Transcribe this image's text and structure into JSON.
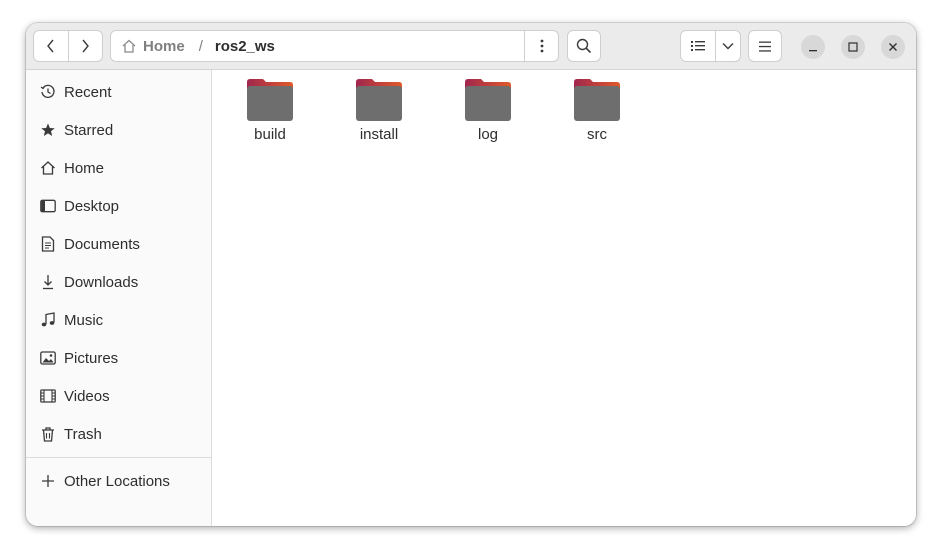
{
  "header": {
    "path_home_label": "Home",
    "path_separator": "/",
    "path_current": "ros2_ws"
  },
  "sidebar": {
    "items": [
      {
        "label": "Recent",
        "icon": "clock-icon"
      },
      {
        "label": "Starred",
        "icon": "star-icon"
      },
      {
        "label": "Home",
        "icon": "home-icon"
      },
      {
        "label": "Desktop",
        "icon": "desktop-icon"
      },
      {
        "label": "Documents",
        "icon": "document-icon"
      },
      {
        "label": "Downloads",
        "icon": "download-icon"
      },
      {
        "label": "Music",
        "icon": "music-note-icon"
      },
      {
        "label": "Pictures",
        "icon": "picture-icon"
      },
      {
        "label": "Videos",
        "icon": "film-icon"
      },
      {
        "label": "Trash",
        "icon": "trash-icon"
      }
    ],
    "other_locations_label": "Other Locations"
  },
  "files": [
    {
      "name": "build"
    },
    {
      "name": "install"
    },
    {
      "name": "log"
    },
    {
      "name": "src"
    }
  ],
  "colors": {
    "folder_tab_start": "#a0264e",
    "folder_tab_end": "#e05a2a",
    "folder_body": "#6e6e6e"
  }
}
